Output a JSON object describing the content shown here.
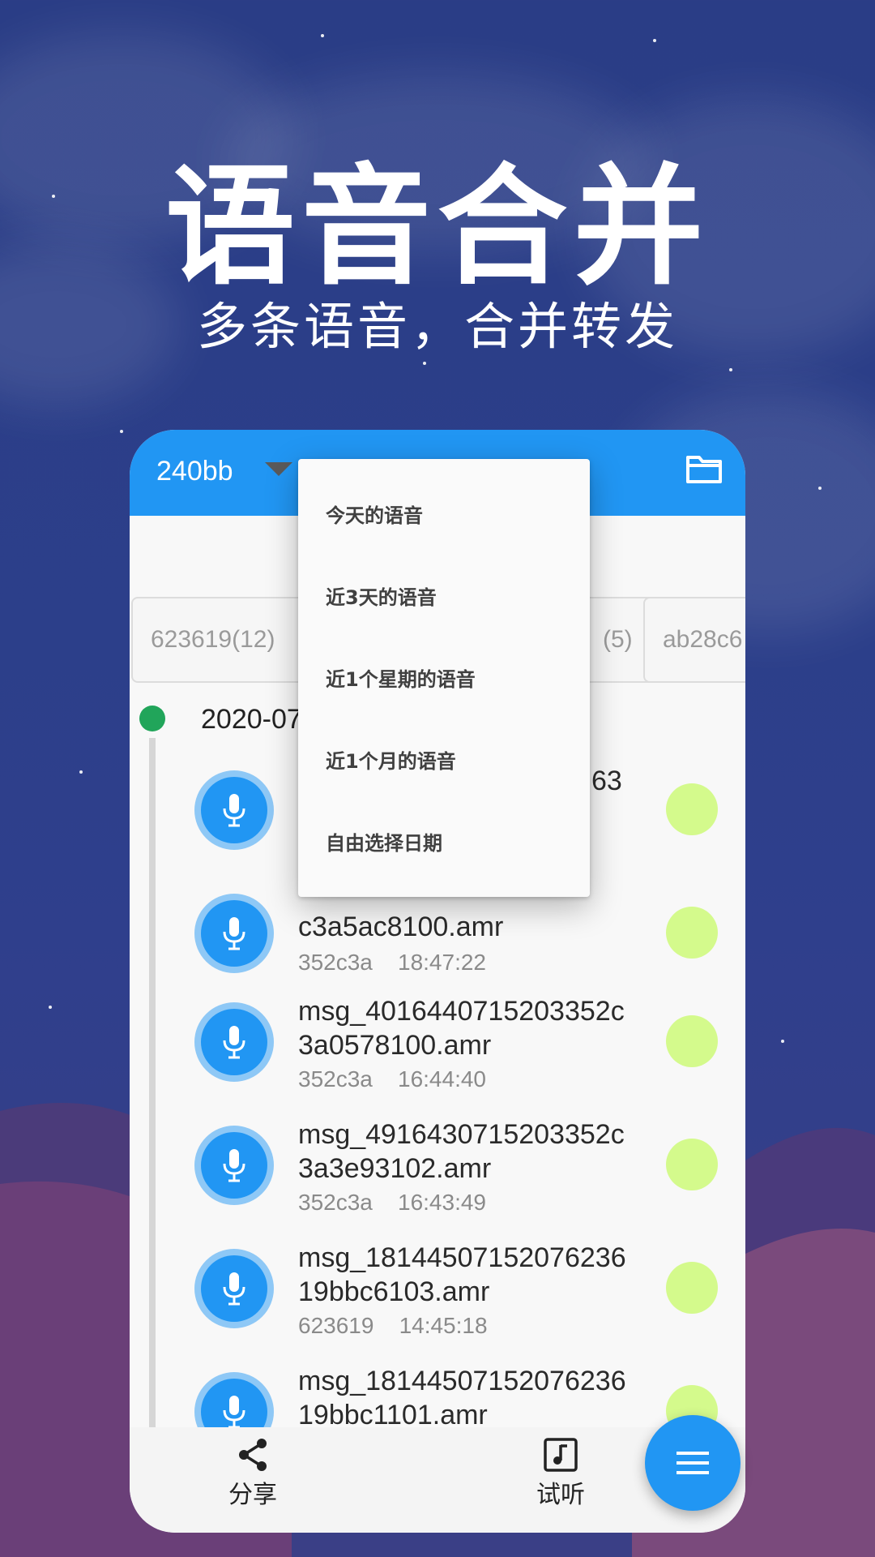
{
  "promo": {
    "title": "语音合并",
    "subtitle": "多条语音，合并转发"
  },
  "appbar": {
    "title": "240bb",
    "caret_icon": "caret-down-icon",
    "folder_icon": "folder-icon"
  },
  "chips": [
    "623619(12)",
    "(5)",
    "ab28c6"
  ],
  "timeline": {
    "date": "2020-07"
  },
  "items": [
    {
      "name": "msg_2216470715203352c3a5ac8100.amr",
      "name_top": "63",
      "user": "",
      "time": ""
    },
    {
      "name": "msg_2216470715203352c3a5ac8100.amr",
      "name_line2": "c3a5ac8100.amr",
      "user": "352c3a",
      "time": "18:47:22"
    },
    {
      "name": "msg_4016440715203352c3a0578100.amr",
      "user": "352c3a",
      "time": "16:44:40"
    },
    {
      "name": "msg_4916430715203352c3a3e93102.amr",
      "user": "352c3a",
      "time": "16:43:49"
    },
    {
      "name": "msg_1814450715207623619bbc6103.amr",
      "user": "623619",
      "time": "14:45:18"
    },
    {
      "name": "msg_1814450715207623619bbc1101.amr",
      "user": "",
      "time": ""
    }
  ],
  "menu": {
    "items": [
      "今天的语音",
      "近3天的语音",
      "近1个星期的语音",
      "近1个月的语音",
      "自由选择日期"
    ]
  },
  "bottom_bar": {
    "share_label": "分享",
    "listen_label": "试听"
  },
  "colors": {
    "primary": "#2196f3",
    "date_dot": "#21a55a",
    "check_dot": "#d4fa8c"
  }
}
